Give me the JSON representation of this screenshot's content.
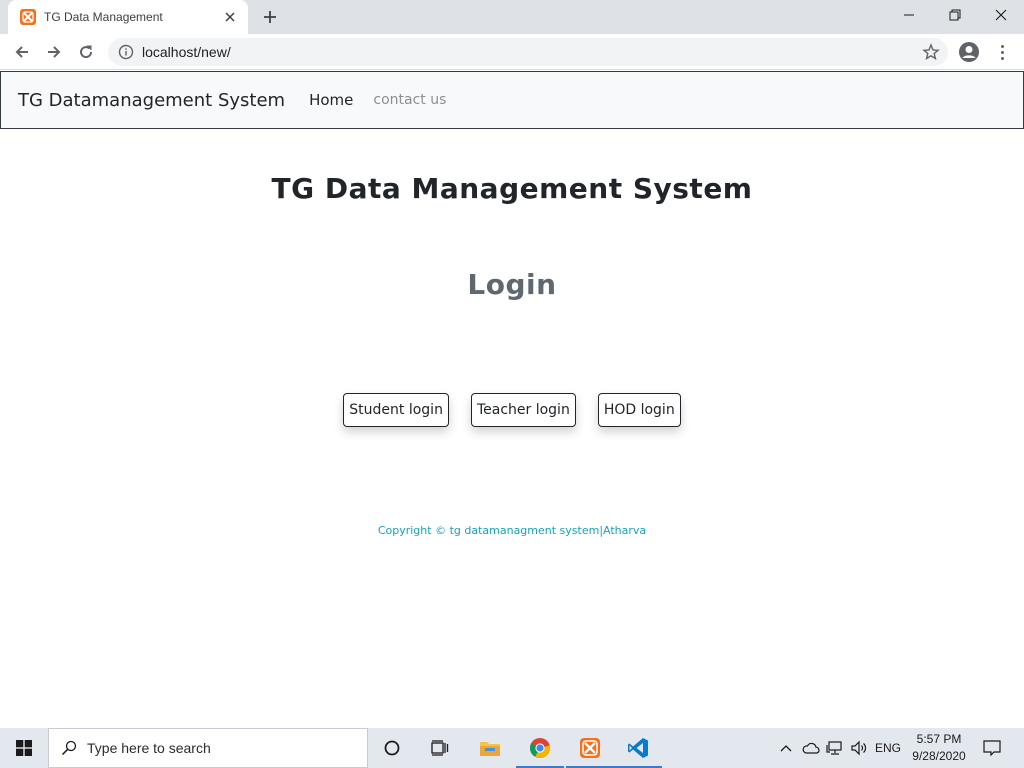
{
  "browser": {
    "tab_title": "TG Data Management",
    "url": "localhost/new/"
  },
  "site": {
    "brand": "TG Datamanagement System",
    "nav": [
      {
        "label": "Home",
        "active": true
      },
      {
        "label": "contact us",
        "active": false
      }
    ],
    "title": "TG Data Management System",
    "subtitle": "Login",
    "login_buttons": [
      "Student login",
      "Teacher login",
      "HOD login"
    ],
    "copyright": "Copyright © tg datamanagment system|Atharva"
  },
  "taskbar": {
    "search_placeholder": "Type here to search",
    "language": "ENG",
    "time": "5:57 PM",
    "date": "9/28/2020"
  },
  "colors": {
    "accent_teal": "#17a2b8",
    "xampp_orange": "#f2711c",
    "vscode_blue": "#0a7acc"
  }
}
